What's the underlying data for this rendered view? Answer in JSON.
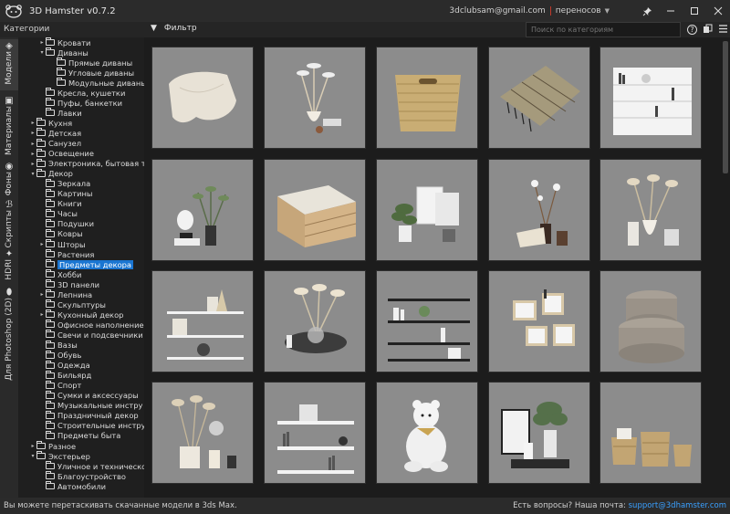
{
  "app": {
    "title": "3D Hamster v0.7.2",
    "email": "3dclubsam@gmail.com",
    "transfers_label": "переносов"
  },
  "toolbar": {
    "categories_label": "Категории",
    "filter_label": "Фильтр",
    "search_placeholder": "Поиск по категориям"
  },
  "side_tabs": [
    {
      "label": "Модели",
      "icon": "cube-icon"
    },
    {
      "label": "Материалы",
      "icon": "material-icon"
    },
    {
      "label": "Фоны",
      "icon": "background-icon"
    },
    {
      "label": "Скрипты",
      "icon": "script-icon"
    },
    {
      "label": "HDRI",
      "icon": "hdri-icon"
    },
    {
      "label": "Для Photoshop (2D)",
      "icon": "photoshop-icon"
    }
  ],
  "tree": [
    {
      "label": "Кровати",
      "level": 2,
      "arrow": "▸"
    },
    {
      "label": "Диваны",
      "level": 2,
      "arrow": "▾"
    },
    {
      "label": "Прямые диваны",
      "level": 3,
      "arrow": ""
    },
    {
      "label": "Угловые диваны",
      "level": 3,
      "arrow": ""
    },
    {
      "label": "Модульные диваны",
      "level": 3,
      "arrow": ""
    },
    {
      "label": "Кресла, кушетки",
      "level": 2,
      "arrow": ""
    },
    {
      "label": "Пуфы, банкетки",
      "level": 2,
      "arrow": ""
    },
    {
      "label": "Лавки",
      "level": 2,
      "arrow": ""
    },
    {
      "label": "Кухня",
      "level": 1,
      "arrow": "▸"
    },
    {
      "label": "Детская",
      "level": 1,
      "arrow": "▸"
    },
    {
      "label": "Санузел",
      "level": 1,
      "arrow": "▸"
    },
    {
      "label": "Освещение",
      "level": 1,
      "arrow": "▸"
    },
    {
      "label": "Электроника, бытовая тех",
      "level": 1,
      "arrow": "▸"
    },
    {
      "label": "Декор",
      "level": 1,
      "arrow": "▾"
    },
    {
      "label": "Зеркала",
      "level": 2,
      "arrow": ""
    },
    {
      "label": "Картины",
      "level": 2,
      "arrow": ""
    },
    {
      "label": "Книги",
      "level": 2,
      "arrow": ""
    },
    {
      "label": "Часы",
      "level": 2,
      "arrow": ""
    },
    {
      "label": "Подушки",
      "level": 2,
      "arrow": ""
    },
    {
      "label": "Ковры",
      "level": 2,
      "arrow": ""
    },
    {
      "label": "Шторы",
      "level": 2,
      "arrow": "▸"
    },
    {
      "label": "Растения",
      "level": 2,
      "arrow": ""
    },
    {
      "label": "Предметы декора",
      "level": 2,
      "arrow": "",
      "selected": true
    },
    {
      "label": "Хобби",
      "level": 2,
      "arrow": ""
    },
    {
      "label": "3D панели",
      "level": 2,
      "arrow": ""
    },
    {
      "label": "Лепнина",
      "level": 2,
      "arrow": "▸"
    },
    {
      "label": "Скульптуры",
      "level": 2,
      "arrow": ""
    },
    {
      "label": "Кухонный декор",
      "level": 2,
      "arrow": "▸"
    },
    {
      "label": "Офисное наполнение",
      "level": 2,
      "arrow": ""
    },
    {
      "label": "Свечи и подсвечники",
      "level": 2,
      "arrow": ""
    },
    {
      "label": "Вазы",
      "level": 2,
      "arrow": ""
    },
    {
      "label": "Обувь",
      "level": 2,
      "arrow": ""
    },
    {
      "label": "Одежда",
      "level": 2,
      "arrow": ""
    },
    {
      "label": "Бильярд",
      "level": 2,
      "arrow": ""
    },
    {
      "label": "Спорт",
      "level": 2,
      "arrow": ""
    },
    {
      "label": "Сумки и аксессуары",
      "level": 2,
      "arrow": ""
    },
    {
      "label": "Музыкальные инстру",
      "level": 2,
      "arrow": ""
    },
    {
      "label": "Праздничный декор",
      "level": 2,
      "arrow": ""
    },
    {
      "label": "Строительные инстру",
      "level": 2,
      "arrow": ""
    },
    {
      "label": "Предметы быта",
      "level": 2,
      "arrow": ""
    },
    {
      "label": "Разное",
      "level": 1,
      "arrow": "▸"
    },
    {
      "label": "Экстерьер",
      "level": 1,
      "arrow": "▾"
    },
    {
      "label": "Уличное и техническо",
      "level": 2,
      "arrow": ""
    },
    {
      "label": "Благоустройство",
      "level": 2,
      "arrow": ""
    },
    {
      "label": "Автомобили",
      "level": 2,
      "arrow": ""
    }
  ],
  "grid": [
    {
      "name": "throw-blanket"
    },
    {
      "name": "pampas-vase-set"
    },
    {
      "name": "wicker-basket"
    },
    {
      "name": "plaid-blanket"
    },
    {
      "name": "shelf-decor"
    },
    {
      "name": "plant-lamp-set"
    },
    {
      "name": "wooden-crate"
    },
    {
      "name": "plants-frames-set"
    },
    {
      "name": "cotton-branch-set"
    },
    {
      "name": "pampas-candles-set"
    },
    {
      "name": "bookshelf-decor"
    },
    {
      "name": "pampas-table-set"
    },
    {
      "name": "black-shelves"
    },
    {
      "name": "cube-shelves"
    },
    {
      "name": "round-boxes"
    },
    {
      "name": "dried-flowers-set"
    },
    {
      "name": "white-shelves-books"
    },
    {
      "name": "white-bear"
    },
    {
      "name": "plant-tray-set"
    },
    {
      "name": "baskets-set"
    }
  ],
  "status": {
    "left_text": "Вы можете перетаскивать скачанные модели в 3ds Max.",
    "right_text": "Есть вопросы? Наша почта: ",
    "support_email": "support@3dhamster.com"
  }
}
